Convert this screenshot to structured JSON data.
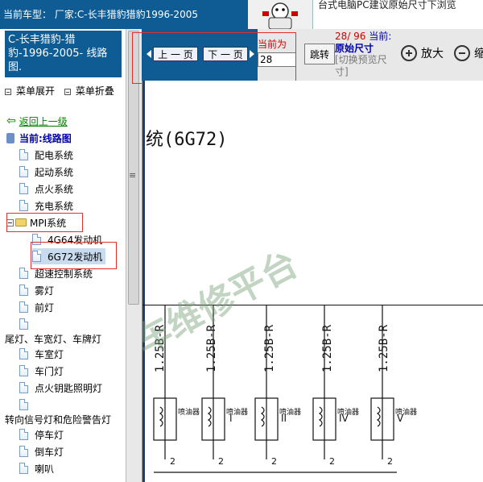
{
  "topbar": {
    "vehicle_label": "当前车型：  厂家:C-长丰猎豹猎豹1996-2005",
    "banner_text": "台式电脑PC建议原始尺寸下浏览"
  },
  "sidebar": {
    "title": "C-长丰猎豹-猎豹-1996-2005- 线路图.",
    "expand_label": "菜单展开",
    "collapse_label": "菜单折叠",
    "back_label": "返回上一级",
    "current_label": "当前:线路图",
    "items": [
      {
        "label": "配电系统"
      },
      {
        "label": "起动系统"
      },
      {
        "label": "点火系统"
      },
      {
        "label": "充电系统"
      }
    ],
    "folder": {
      "label": "MPI系统"
    },
    "folder_children": [
      {
        "label": "4G64发动机"
      },
      {
        "label": "6G72发动机"
      }
    ],
    "items2": [
      {
        "label": "超速控制系统"
      },
      {
        "label": "雾灯"
      },
      {
        "label": "前灯"
      },
      {
        "label": ""
      },
      {
        "label": "尾灯、车宽灯、车牌灯"
      },
      {
        "label": "车室灯"
      },
      {
        "label": "车门灯"
      },
      {
        "label": "点火钥匙照明灯"
      },
      {
        "label": ""
      },
      {
        "label": "转向信号灯和危险警告灯"
      },
      {
        "label": "停车灯"
      },
      {
        "label": "倒车灯"
      },
      {
        "label": "喇叭"
      }
    ]
  },
  "viewer": {
    "prev_label": "上 一 页",
    "next_label": "下 一 页",
    "current_label": "当前为",
    "page_input_value": "28",
    "jump_label": "跳转",
    "page_count": "28/ 96",
    "current_word": "当前:",
    "orig_size_label": "原始尺寸",
    "switch_hint": "[切换预览尺寸]",
    "zoom_in_label": "放大",
    "zoom_out_label": "缩"
  },
  "diagram": {
    "title": "统(6G72)",
    "watermark": "车维修平台",
    "wire_labels": [
      "1.25B-R",
      "1.25B-R",
      "1.25B-R",
      "1.25B-R",
      "1.25B-R"
    ],
    "injector_label": "喷油器",
    "injector_numbers": [
      "I",
      "II",
      "IV",
      "V"
    ],
    "pin_number": "2"
  },
  "colors": {
    "header_blue": "#0f5b93",
    "highlight_red": "#e03030",
    "link_green": "#008000"
  }
}
